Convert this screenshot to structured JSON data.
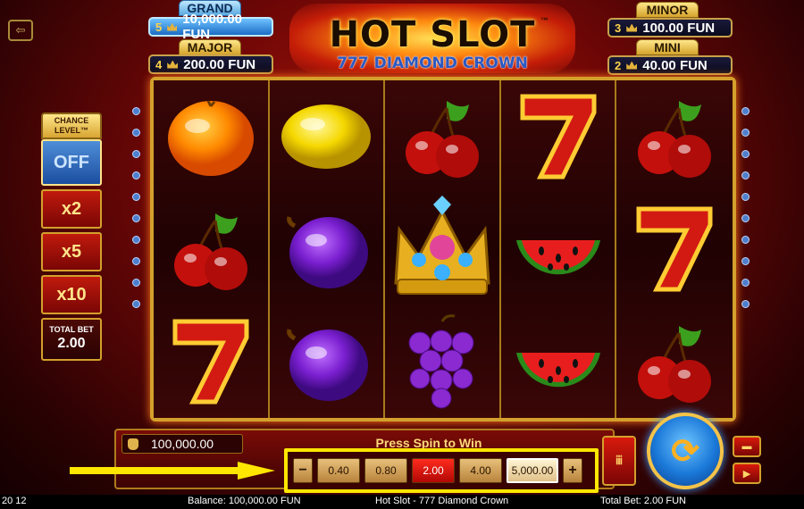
{
  "jackpots": {
    "grand": {
      "label": "GRAND",
      "count": "5",
      "amount": "10,000.00 FUN"
    },
    "major": {
      "label": "MAJOR",
      "count": "4",
      "amount": "200.00 FUN"
    },
    "minor": {
      "label": "MINOR",
      "count": "3",
      "amount": "100.00 FUN"
    },
    "mini": {
      "label": "MINI",
      "count": "2",
      "amount": "40.00 FUN"
    }
  },
  "title": {
    "main": "HOT SLOT",
    "tm": "™",
    "sub": "777 DIAMOND CROWN"
  },
  "chance": {
    "header": "CHANCE LEVEL™",
    "off": "OFF",
    "x2": "x2",
    "x5": "x5",
    "x10": "x10",
    "total_label": "TOTAL BET",
    "total_value": "2.00"
  },
  "reels": [
    [
      "orange",
      "cherry",
      "seven"
    ],
    [
      "lemon",
      "plum",
      "plum"
    ],
    [
      "cherry",
      "crown",
      "grapes"
    ],
    [
      "seven",
      "watermelon",
      "watermelon"
    ],
    [
      "cherry",
      "seven",
      "cherry"
    ]
  ],
  "panel": {
    "balance_value": "100,000.00",
    "press_text": "Press Spin to Win",
    "bet_minus": "−",
    "bet_plus": "+",
    "bets": [
      "0.40",
      "0.80",
      "2.00",
      "4.00",
      "5,000.00"
    ],
    "turbo_label": "ⅲ",
    "spin_glyph": "⟳"
  },
  "status": {
    "time": "20 12",
    "balance": "Balance: 100,000.00 FUN",
    "game": "Hot Slot - 777 Diamond Crown",
    "total_bet": "Total Bet: 2.00 FUN"
  },
  "colors": {
    "highlight": "#ffe600",
    "active_bet": "#ff2b1e",
    "frame": "#d4a02c"
  }
}
